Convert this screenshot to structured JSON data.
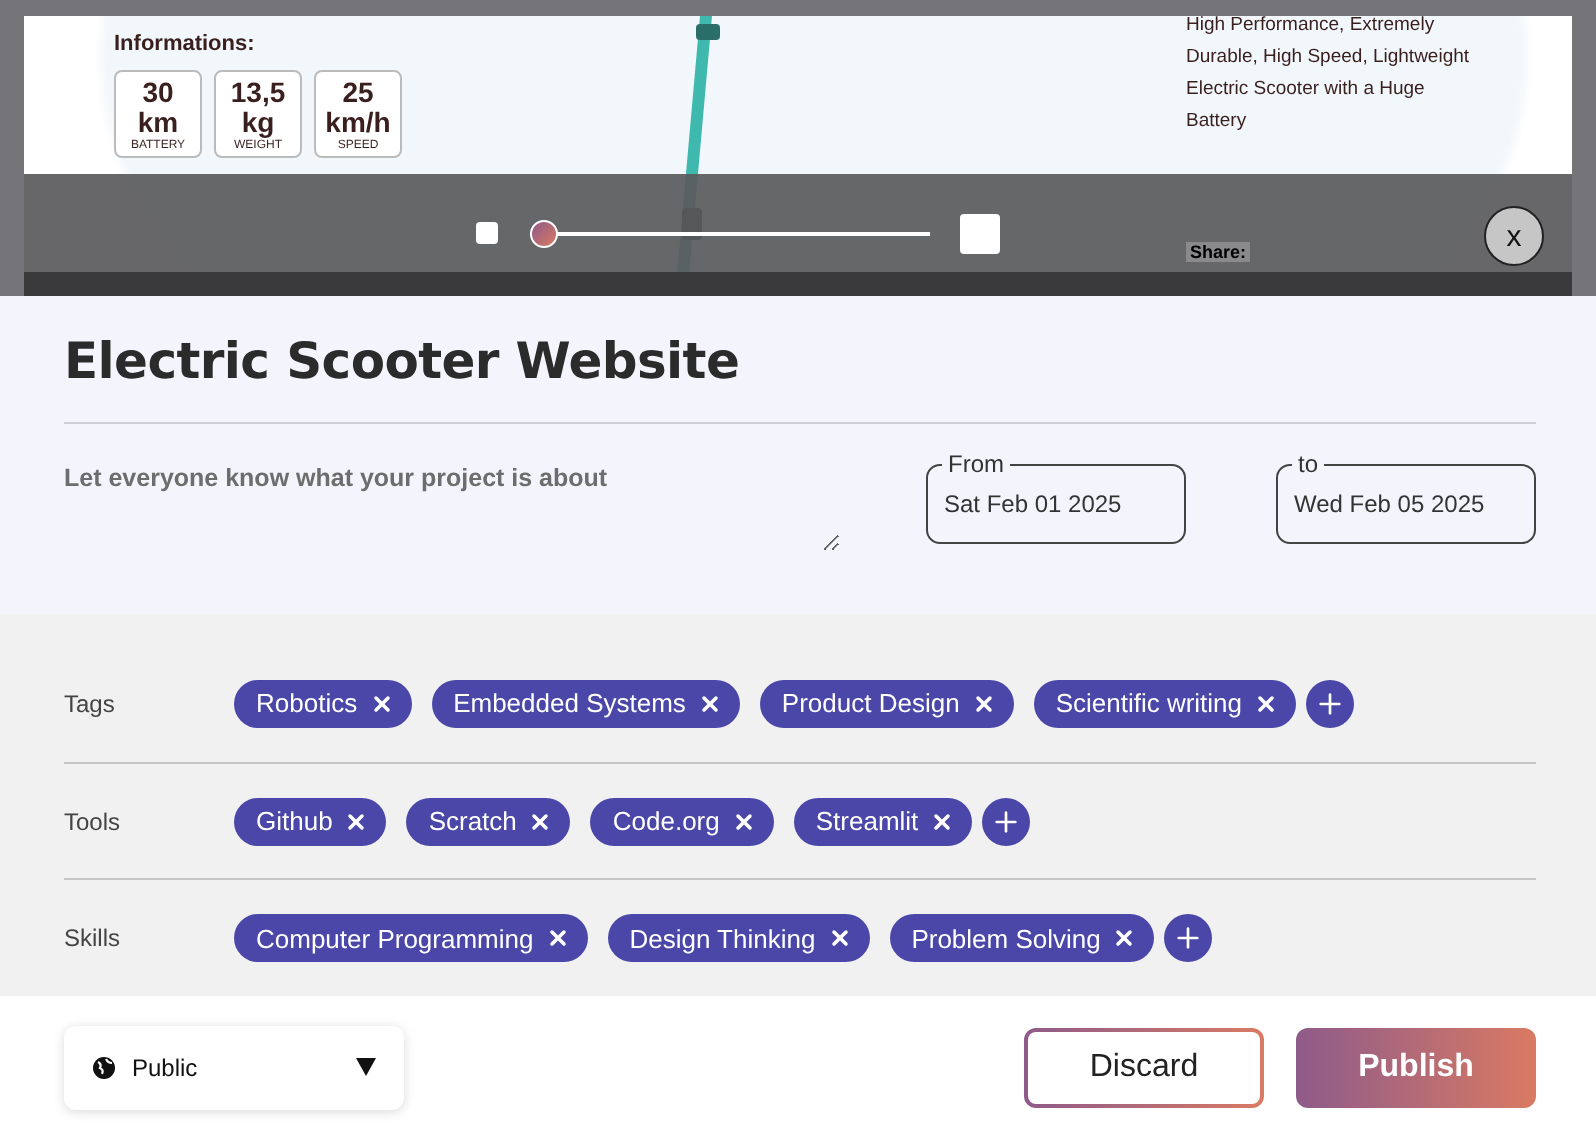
{
  "preview": {
    "info_heading": "Informations:",
    "stats": [
      {
        "value": "30",
        "unit": "km",
        "label": "BATTERY"
      },
      {
        "value": "13,5",
        "unit": "kg",
        "label": "WEIGHT"
      },
      {
        "value": "25",
        "unit": "km/h",
        "label": "SPEED"
      }
    ],
    "description_lines": [
      "High Performance, Extremely",
      "Durable, High Speed, Lightweight",
      "Electric Scooter with a Huge",
      "Battery"
    ],
    "share_label": "Share:"
  },
  "zoom": {
    "level": 0
  },
  "close_label": "x",
  "project": {
    "title": "Electric Scooter Website",
    "description": {
      "placeholder": "Let everyone know what your project is about"
    },
    "date_from": {
      "label": "From",
      "value": "Sat Feb 01 2025"
    },
    "date_to": {
      "label": "to",
      "value": "Wed Feb 05 2025"
    }
  },
  "sections": [
    {
      "label": "Tags",
      "chips": [
        "Robotics",
        "Embedded Systems",
        "Product Design",
        "Scientific writing"
      ]
    },
    {
      "label": "Tools",
      "chips": [
        "Github",
        "Scratch",
        "Code.org",
        "Streamlit"
      ]
    },
    {
      "label": "Skills",
      "chips": [
        "Computer Programming",
        "Design Thinking",
        "Problem Solving"
      ]
    }
  ],
  "footer": {
    "visibility": {
      "value": "Public"
    },
    "discard": "Discard",
    "publish": "Publish"
  }
}
